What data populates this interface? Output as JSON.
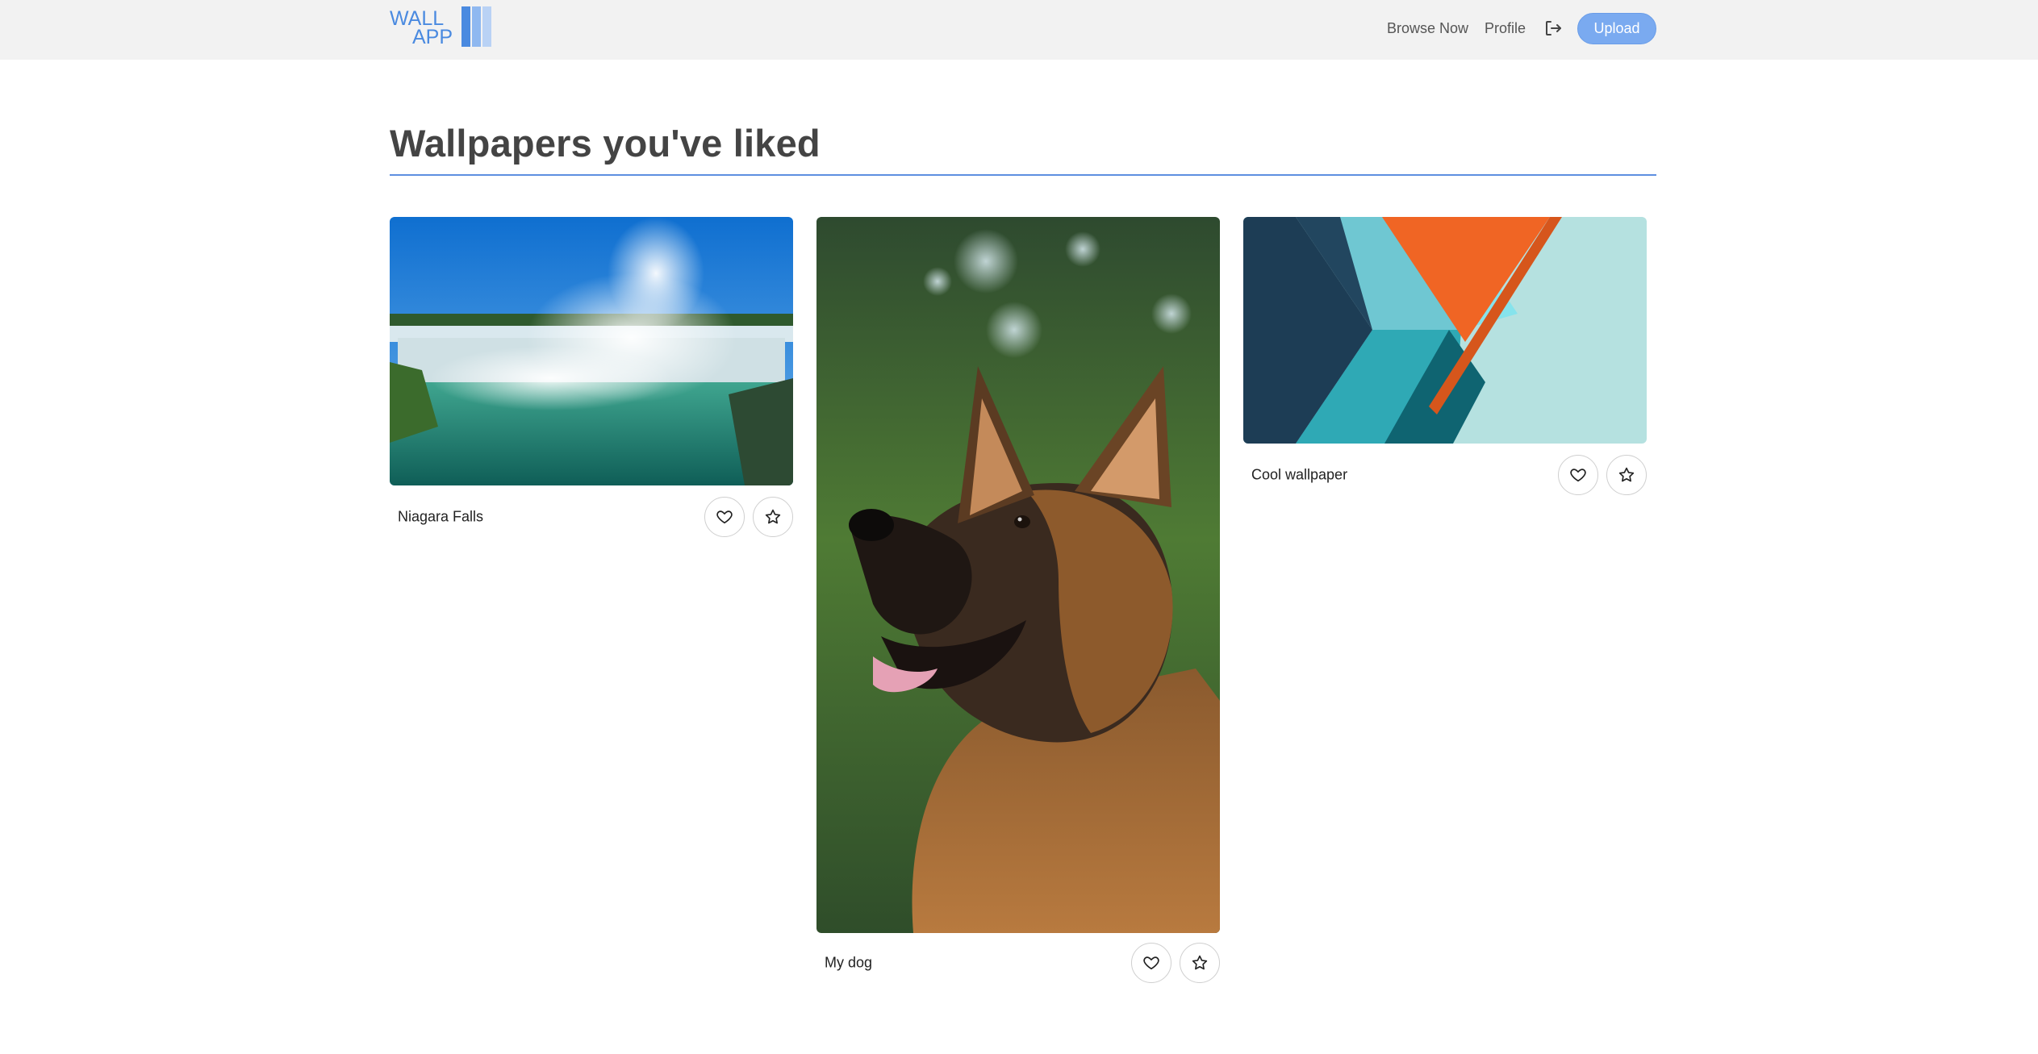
{
  "brand": {
    "logo_line1": "WALL",
    "logo_line2": "APP",
    "accent": "#4a8ae0"
  },
  "nav": {
    "browse_label": "Browse Now",
    "profile_label": "Profile",
    "logout_icon": "logout-icon",
    "upload_label": "Upload"
  },
  "page": {
    "title": "Wallpapers you've liked"
  },
  "wallpapers": [
    {
      "title": "Niagara Falls",
      "image": "waterfall-photo",
      "like_icon": "heart-icon",
      "favorite_icon": "star-icon"
    },
    {
      "title": "My dog",
      "image": "german-shepherd-photo",
      "like_icon": "heart-icon",
      "favorite_icon": "star-icon"
    },
    {
      "title": "Cool wallpaper",
      "image": "geometric-abstract-art",
      "like_icon": "heart-icon",
      "favorite_icon": "star-icon"
    }
  ],
  "colors": {
    "navbar_bg": "#f2f2f2",
    "upload_bg": "#7aaaf0",
    "title_rule": "#5d8fe0",
    "title_text": "#444444"
  }
}
